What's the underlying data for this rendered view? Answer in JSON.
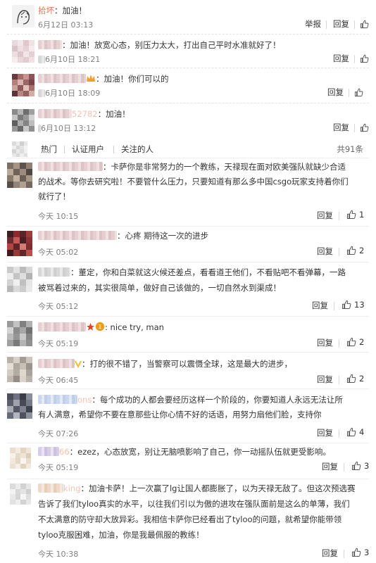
{
  "ui": {
    "reply_label": "回复",
    "report_label": "举报"
  },
  "tabs": {
    "hot": "热门",
    "verified": "认证用户",
    "following": "关注的人",
    "total": "共91条"
  },
  "top_replies": [
    {
      "username": "拾坏",
      "text": "：加油！",
      "time": "6月12日 03:13"
    },
    {
      "text": "：加油！放宽心态，别压力太大，打出自己平时水准就好了！",
      "time": "6月10日 18:21"
    },
    {
      "text": "：加油！你们可以的",
      "time": "6月10日 18:09"
    },
    {
      "username_suffix": "52782",
      "text": "：加油！",
      "time": "6月10日 13:12"
    }
  ],
  "comments": [
    {
      "lines": [
        "：卡萨你是非常努力的一个教练，天禄现在面对欧美强队就缺少合适",
        "的战术。等你去研究啦！不要管什么压力，只要知道有那么多中国csgo玩家支持着你们",
        "就行了！"
      ],
      "time": "今天 10:15",
      "likes": "1"
    },
    {
      "lines": [
        "：心疼 期待这一次的进步"
      ],
      "time": "今天 05:02",
      "likes": "2"
    },
    {
      "lines": [
        "：董定，你和白菜就这火候还差点，看看道王他们，不看贴吧不看弹幕，一路",
        "被骂着过来的，其实很简单，做好自己该做的，一切自然水到渠成！"
      ],
      "time": "今天 05:12",
      "likes": "13"
    },
    {
      "lines": [
        ": nice try, man"
      ],
      "time": "今天 05:19",
      "likes": "2"
    },
    {
      "lines": [
        "：打的很不错了，当警察可以震慑全球，这是最大的进步，"
      ],
      "time": "今天 06:45",
      "likes": "2"
    },
    {
      "name_tail": "ons",
      "lines": [
        "：每个成功的人都会要经历这样一个阶段的，你要知道人永远无法让所",
        "有人满意，希望你不要在意那些让你心情不好的话语，用努力扇他们脸，支持你"
      ],
      "time": "今天 07:26",
      "likes": "4"
    },
    {
      "name_tail": "66",
      "lines": [
        "：ezez，心态放宽，别让无脑喷影响了自己，你一动摇队伍就更受影响。"
      ],
      "time": "今天 05:19",
      "likes": "3"
    },
    {
      "name_tail": "king",
      "lines": [
        "：加油卡萨！上一次赢了lg让国人都膨胀了，以为天禄无敌了。但这次预选赛",
        "告诉了我们tyloo真实的水平，以往我们引以为傲的进攻在强队面前是这么的单薄，我们",
        "不太满意的防守却大放异彩。我相信卡萨你已经看出了tyloo的问题，就希望你能带领",
        "tyloo克服困难，加油，你是我最佩服的教练！"
      ],
      "time": "今天 10:38",
      "likes": "3"
    }
  ],
  "colors": {
    "username": "#eb7350",
    "meta": "#808080",
    "divider": "#eeeeee"
  },
  "icons": {
    "like": "thumbs-up-icon"
  }
}
